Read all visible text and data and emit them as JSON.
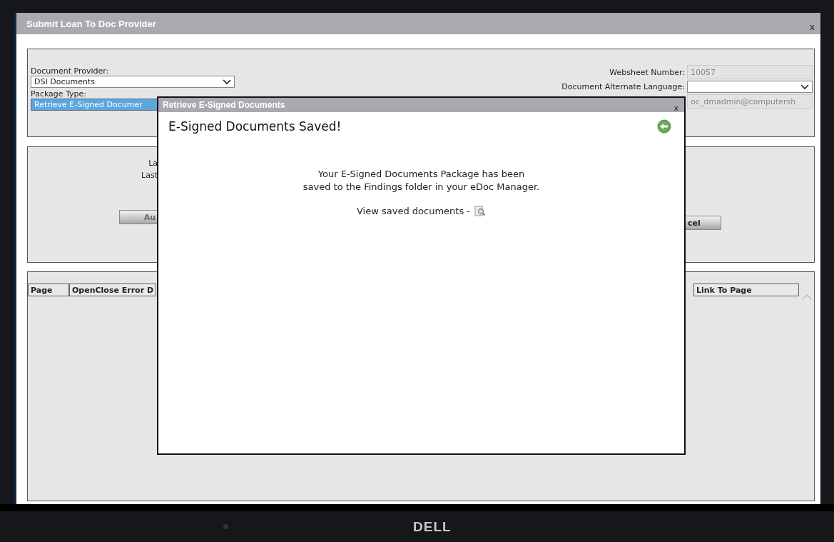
{
  "window": {
    "title": "Submit Loan To Doc Provider",
    "close": "x"
  },
  "form": {
    "provider_label": "Document Provider:",
    "provider_value": "DSI Documents",
    "package_label": "Package Type:",
    "package_value": "Retrieve E-Signed Documer",
    "websheet_label": "Websheet Number:",
    "websheet_value": "10057",
    "language_label": "Document Alternate Language:",
    "email_value": "oc_dmadmin@computersh"
  },
  "status": {
    "lines": [
      "La",
      "Last"
    ],
    "buttons": [
      {
        "label": "Au",
        "disabled": true
      },
      {
        "label": "cel",
        "disabled": false
      }
    ]
  },
  "table": {
    "columns": [
      "Page",
      "OpenClose Error D",
      "Link To Page"
    ]
  },
  "dialog": {
    "title": "Retrieve E-Signed Documents",
    "close": "x",
    "heading": "E-Signed Documents Saved!",
    "message_lines": [
      "Your E-Signed Documents Package has been",
      "saved to the Findings folder in your eDoc Manager."
    ],
    "link_text": "View saved documents -"
  },
  "device": {
    "brand": "DELL"
  }
}
